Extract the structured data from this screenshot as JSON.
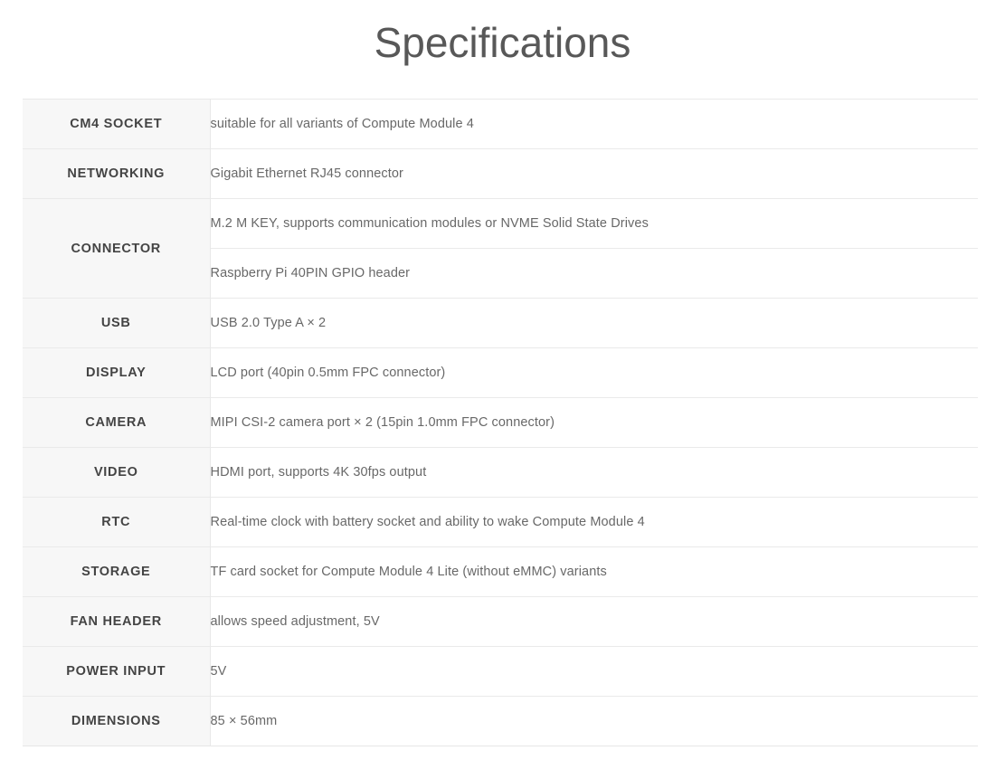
{
  "page": {
    "title": "Specifications"
  },
  "spec_table": {
    "rows": [
      {
        "label": "CM4 SOCKET",
        "values": [
          "suitable for all variants of Compute Module 4"
        ]
      },
      {
        "label": "NETWORKING",
        "values": [
          "Gigabit Ethernet RJ45 connector"
        ]
      },
      {
        "label": "CONNECTOR",
        "values": [
          "M.2 M KEY, supports communication modules or NVME Solid State Drives",
          "Raspberry Pi 40PIN GPIO header"
        ]
      },
      {
        "label": "USB",
        "values": [
          "USB 2.0 Type A × 2"
        ]
      },
      {
        "label": "DISPLAY",
        "values": [
          "LCD port (40pin 0.5mm FPC connector)"
        ]
      },
      {
        "label": "CAMERA",
        "values": [
          "MIPI CSI-2 camera port × 2 (15pin 1.0mm FPC connector)"
        ]
      },
      {
        "label": "VIDEO",
        "values": [
          "HDMI port, supports 4K 30fps output"
        ]
      },
      {
        "label": "RTC",
        "values": [
          "Real-time clock with battery socket and ability to wake Compute Module 4"
        ]
      },
      {
        "label": "STORAGE",
        "values": [
          "TF card socket for Compute Module 4 Lite (without eMMC) variants"
        ]
      },
      {
        "label": "FAN HEADER",
        "values": [
          "allows speed adjustment, 5V"
        ]
      },
      {
        "label": "POWER INPUT",
        "values": [
          "5V"
        ]
      },
      {
        "label": "DIMENSIONS",
        "values": [
          "85 × 56mm"
        ]
      }
    ]
  },
  "colors": {
    "title_text": "#585858",
    "label_text": "#444444",
    "label_bg": "#f7f7f7",
    "value_text": "#686868",
    "border": "#eaeaea",
    "page_bg": "#ffffff"
  }
}
